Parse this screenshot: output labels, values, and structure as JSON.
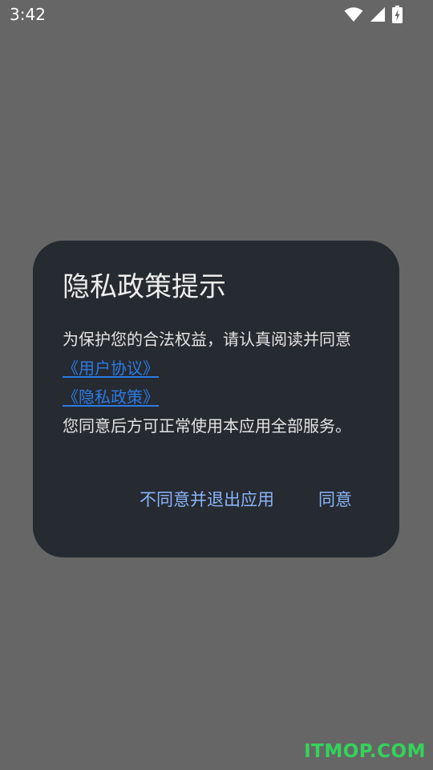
{
  "status_bar": {
    "time": "3:42",
    "icons": [
      "wifi-icon",
      "cell-signal-icon",
      "battery-charging-icon"
    ]
  },
  "dialog": {
    "title": "隐私政策提示",
    "intro": "为保护您的合法权益，请认真阅读并同意",
    "user_agreement_link": "《用户协议》",
    "privacy_policy_link": "《隐私政策》",
    "outro": "您同意后方可正常使用本应用全部服务。",
    "decline_label": "不同意并退出应用",
    "agree_label": "同意"
  },
  "watermark": "ITMOP.COM",
  "colors": {
    "background_scrim": "#666666",
    "dialog_background": "#262a31",
    "link": "#2c7be5",
    "button_text": "#8ab4f8",
    "watermark": "#33d35a"
  }
}
